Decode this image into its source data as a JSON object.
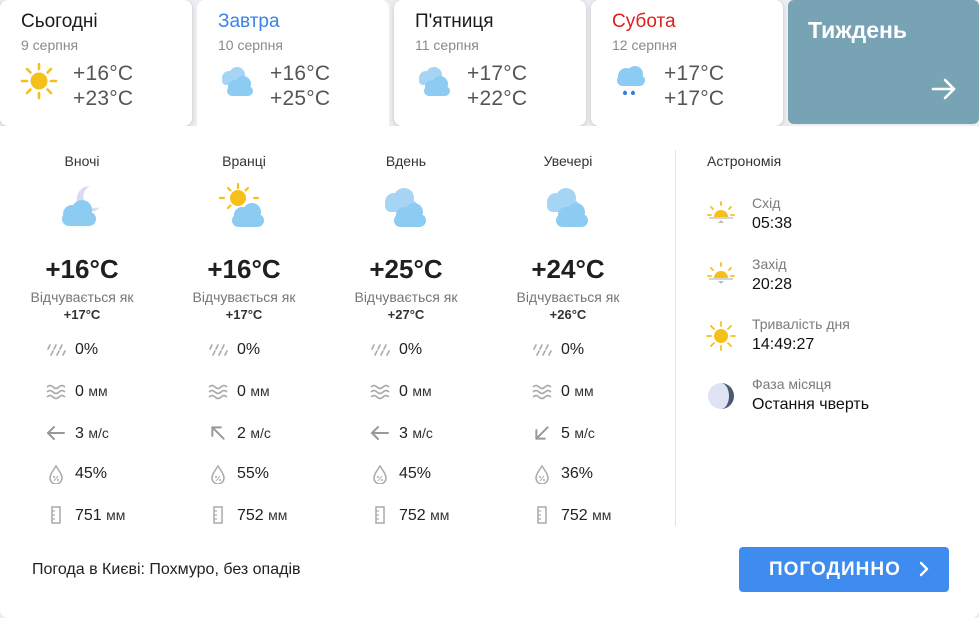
{
  "days": [
    {
      "name": "Сьогодні",
      "date": "9 серпня",
      "temp_min": "+16°C",
      "temp_max": "+23°C",
      "icon": "sun-icon"
    },
    {
      "name": "Завтра",
      "date": "10 серпня",
      "temp_min": "+16°C",
      "temp_max": "+25°C",
      "icon": "cloud-sun-icon"
    },
    {
      "name": "П'ятниця",
      "date": "11 серпня",
      "temp_min": "+17°C",
      "temp_max": "+22°C",
      "icon": "cloud-sun-icon"
    },
    {
      "name": "Субота",
      "date": "12 серпня",
      "temp_min": "+17°C",
      "temp_max": "+17°C",
      "icon": "cloud-rain-icon"
    }
  ],
  "week": {
    "label": "Тиждень"
  },
  "periods": [
    {
      "name": "Вночі",
      "icon": "cloud-moon-icon",
      "temp": "+16°C",
      "feels_label": "Відчувається як",
      "feels": "+17°C",
      "precip_prob": "0%",
      "precip": "0",
      "precip_unit": "мм",
      "wind": "3",
      "wind_unit": "м/с",
      "wind_dir": "west",
      "humidity": "45%",
      "pressure": "751",
      "pressure_unit": "мм"
    },
    {
      "name": "Вранці",
      "icon": "cloud-sun-icon",
      "temp": "+16°C",
      "feels_label": "Відчувається як",
      "feels": "+17°C",
      "precip_prob": "0%",
      "precip": "0",
      "precip_unit": "мм",
      "wind": "2",
      "wind_unit": "м/с",
      "wind_dir": "northwest",
      "humidity": "55%",
      "pressure": "752",
      "pressure_unit": "мм"
    },
    {
      "name": "Вдень",
      "icon": "cloud-sun-icon",
      "temp": "+25°C",
      "feels_label": "Відчувається як",
      "feels": "+27°C",
      "precip_prob": "0%",
      "precip": "0",
      "precip_unit": "мм",
      "wind": "3",
      "wind_unit": "м/с",
      "wind_dir": "west",
      "humidity": "45%",
      "pressure": "752",
      "pressure_unit": "мм"
    },
    {
      "name": "Увечері",
      "icon": "cloud-sun-icon",
      "temp": "+24°C",
      "feels_label": "Відчувається як",
      "feels": "+26°C",
      "precip_prob": "0%",
      "precip": "0",
      "precip_unit": "мм",
      "wind": "5",
      "wind_unit": "м/с",
      "wind_dir": "southwest",
      "humidity": "36%",
      "pressure": "752",
      "pressure_unit": "мм"
    }
  ],
  "astronomy": {
    "title": "Астрономія",
    "sunrise_label": "Схід",
    "sunrise": "05:38",
    "sunset_label": "Захід",
    "sunset": "20:28",
    "day_length_label": "Тривалість дня",
    "day_length": "14:49:27",
    "moon_phase_label": "Фаза місяця",
    "moon_phase": "Остання чверть"
  },
  "summary": "Погода в Києві: Похмуро, без опадів",
  "hourly_button": "ПОГОДИННО",
  "colors": {
    "accent": "#3e8cf0",
    "week_bg": "#78a3b4",
    "red": "#e01d1d",
    "blue": "#3b82e8",
    "sun": "#f5c01c",
    "cloud": "#8ccbf2"
  }
}
